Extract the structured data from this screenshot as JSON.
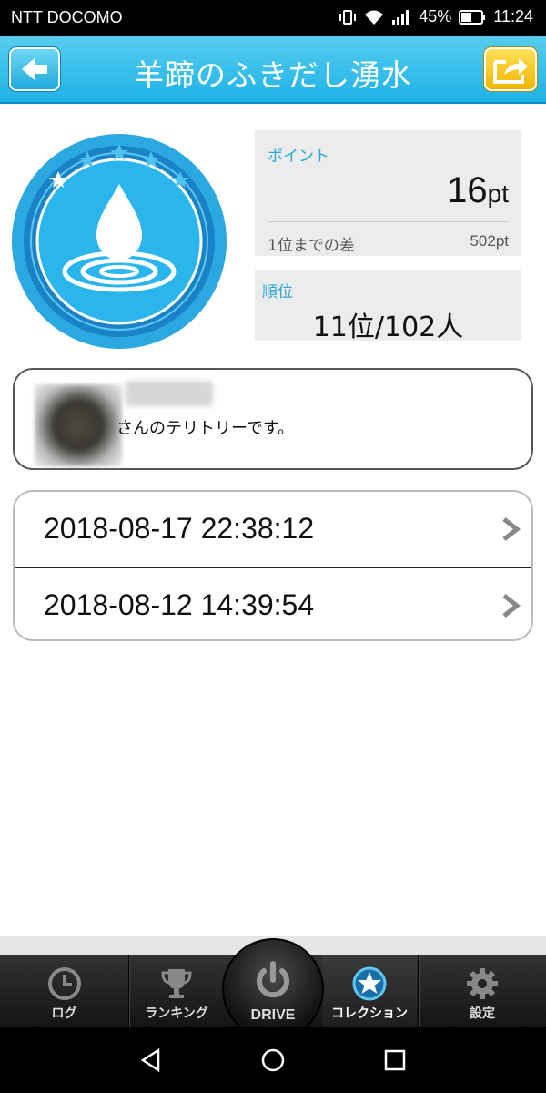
{
  "status": {
    "carrier": "NTT DOCOMO",
    "battery": "45%",
    "time": "11:24"
  },
  "header": {
    "title": "羊蹄のふきだし湧水",
    "back_icon": "arrow-left-icon",
    "share_icon": "share-arrow-icon"
  },
  "badge": {
    "icon": "water-drop-ripple-icon",
    "colors": {
      "outer": "#2b9ad8",
      "inner": "#22b4ea",
      "white": "#ffffff"
    }
  },
  "points": {
    "label": "ポイント",
    "value": "16",
    "unit": "pt",
    "diff_label": "1位までの差",
    "diff_value": "502pt"
  },
  "rank": {
    "label": "順位",
    "value": "11位/102人"
  },
  "territory": {
    "text": "さんのテリトリーです。"
  },
  "logs": [
    {
      "datetime": "2018-08-17 22:38:12"
    },
    {
      "datetime": "2018-08-12 14:39:54"
    }
  ],
  "tabs": [
    {
      "label": "ログ",
      "icon": "clock-icon"
    },
    {
      "label": "ランキング",
      "icon": "trophy-icon"
    },
    {
      "label": "DRIVE",
      "icon": "power-icon"
    },
    {
      "label": "コレクション",
      "icon": "star-circle-icon"
    },
    {
      "label": "設定",
      "icon": "gear-icon"
    }
  ],
  "colors": {
    "header": "#1fb2e6",
    "accent_label": "#2aa7d4",
    "share_button": "#f0b400",
    "tabbar": "#1e1e1e"
  }
}
